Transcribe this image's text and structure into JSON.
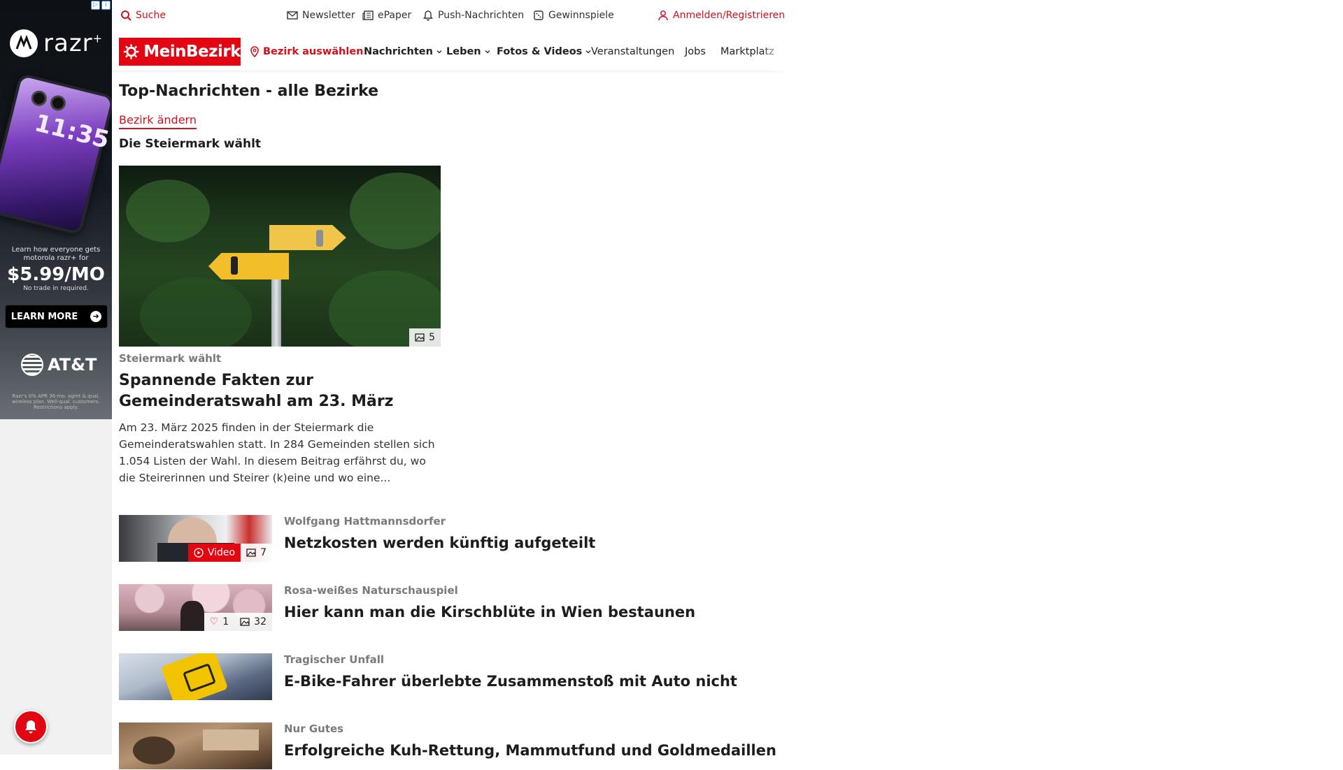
{
  "ad": {
    "brand": "razr",
    "brand_sup": "+",
    "phone_time": "11:35",
    "line1": "Learn how everyone gets motorola razr+ for",
    "price": "$5.99/MO",
    "note": "No trade in required.",
    "cta": "LEARN MORE",
    "carrier": "AT&T",
    "fine_print": "Razr's 0% APR 36-mo. agmt & qual. wireless plan. Well-qual. customers. Restrictions apply."
  },
  "topbar": {
    "search": "Suche",
    "newsletter": "Newsletter",
    "epaper": "ePaper",
    "push": "Push-Nachrichten",
    "contests": "Gewinnspiele",
    "login": "Anmelden/Registrieren"
  },
  "nav": {
    "logo": "MeinBezirk",
    "district": "Bezirk auswählen",
    "items": [
      "Nachrichten",
      "Leben",
      "Fotos & Videos",
      "Veranstaltungen",
      "Jobs",
      "Marktplatz"
    ]
  },
  "main": {
    "heading": "Top-Nachrichten - alle Bezirke",
    "change_district": "Bezirk ändern",
    "section": "Die Steiermark wählt",
    "hero": {
      "photo_count": "5",
      "kicker": "Steiermark wählt",
      "title": "Spannende Fakten zur Gemeinderatswahl am 23. März",
      "teaser": "Am 23. März 2025 finden in der Steiermark die Gemeinderatswahlen statt. In 284 Gemeinden stellen sich 1.054 Listen der Wahl. In diesem Beitrag erfährst du, wo die Steirerinnen und Steirer (k)eine und wo eine..."
    },
    "articles": [
      {
        "kicker": "Wolfgang Hattmannsdorfer",
        "title": "Netzkosten werden künftig aufgeteilt",
        "video": "Video",
        "photos": "7"
      },
      {
        "kicker": "Rosa-weißes Naturschauspiel",
        "title": "Hier kann man die Kirschblüte in Wien bestaunen",
        "likes": "1",
        "photos": "32"
      },
      {
        "kicker": "Tragischer Unfall",
        "title": "E-Bike-Fahrer überlebte Zusammenstoß mit Auto nicht"
      },
      {
        "kicker": "Nur Gutes",
        "title": "Erfolgreiche Kuh-Rettung, Mammutfund und Goldmedaillen"
      }
    ]
  }
}
